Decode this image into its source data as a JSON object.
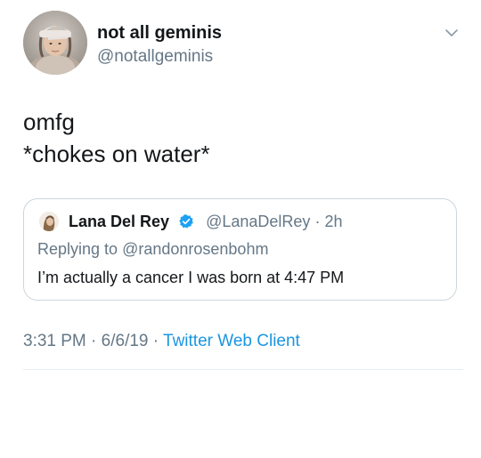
{
  "tweet": {
    "display_name": "not all geminis",
    "handle": "@notallgeminis",
    "text_lines": [
      "omfg",
      "*chokes on water*"
    ],
    "time": "3:31 PM",
    "separator": "·",
    "date": "6/6/19",
    "client": "Twitter Web Client"
  },
  "quoted_tweet": {
    "display_name": "Lana Del Rey",
    "handle": "@LanaDelRey",
    "separator": "·",
    "age": "2h",
    "replying_prefix": "Replying to",
    "replying_to": "@randonrosenbohm",
    "text": "I’m actually a cancer I was born at 4:47 PM"
  },
  "icons": {
    "menu": "chevron-down-icon",
    "verified": "verified-badge-icon"
  },
  "colors": {
    "primary_text": "#14171a",
    "secondary_text": "#657786",
    "link": "#1b95e0",
    "verified": "#1da1f2",
    "border": "#ccd6dd"
  }
}
